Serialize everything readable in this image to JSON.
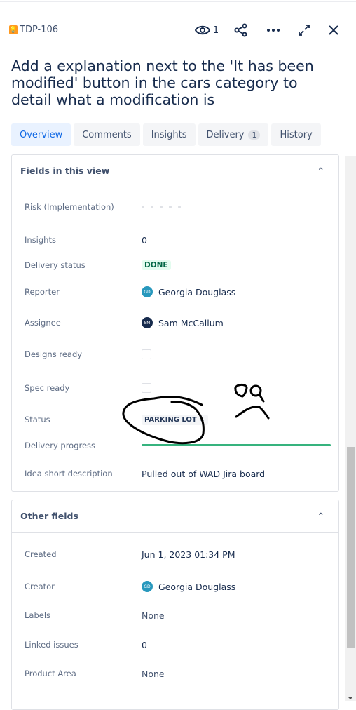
{
  "issue": {
    "key": "TDP-106",
    "icon": "lightbulb-icon",
    "title": "Add a explanation next to the 'It has been modified' button in the cars category to detail what a modification is"
  },
  "actions": {
    "watchers": "1"
  },
  "tabs": [
    {
      "label": "Overview",
      "active": true
    },
    {
      "label": "Comments"
    },
    {
      "label": "Insights"
    },
    {
      "label": "Delivery",
      "badge": "1"
    },
    {
      "label": "History"
    }
  ],
  "fields_section": {
    "title": "Fields in this view",
    "risk_label": "Risk (Implementation)",
    "risk_value": 0,
    "insights_label": "Insights",
    "insights_value": "0",
    "delivery_status_label": "Delivery status",
    "delivery_status_value": "DONE",
    "reporter_label": "Reporter",
    "reporter_initials": "GD",
    "reporter_name": "Georgia Douglass",
    "assignee_label": "Assignee",
    "assignee_initials": "SM",
    "assignee_name": "Sam McCallum",
    "designs_ready_label": "Designs ready",
    "designs_ready": false,
    "spec_ready_label": "Spec ready",
    "spec_ready": false,
    "status_label": "Status",
    "status_value": "PARKING LOT",
    "delivery_progress_label": "Delivery progress",
    "delivery_progress_percent": 100,
    "idea_label": "Idea short description",
    "idea_value": "Pulled out of WAD Jira board"
  },
  "other_section": {
    "title": "Other fields",
    "created_label": "Created",
    "created_value": "Jun 1, 2023 01:34 PM",
    "creator_label": "Creator",
    "creator_initials": "GD",
    "creator_name": "Georgia Douglass",
    "labels_label": "Labels",
    "labels_value": "None",
    "linked_label": "Linked issues",
    "linked_value": "0",
    "product_area_label": "Product Area",
    "product_area_value": "None"
  },
  "colors": {
    "accent": "#0c66e4",
    "progress": "#36b37e",
    "done_bg": "#e3fcef",
    "gd_avatar": "#2898bd",
    "sm_avatar": "#172b4d"
  }
}
